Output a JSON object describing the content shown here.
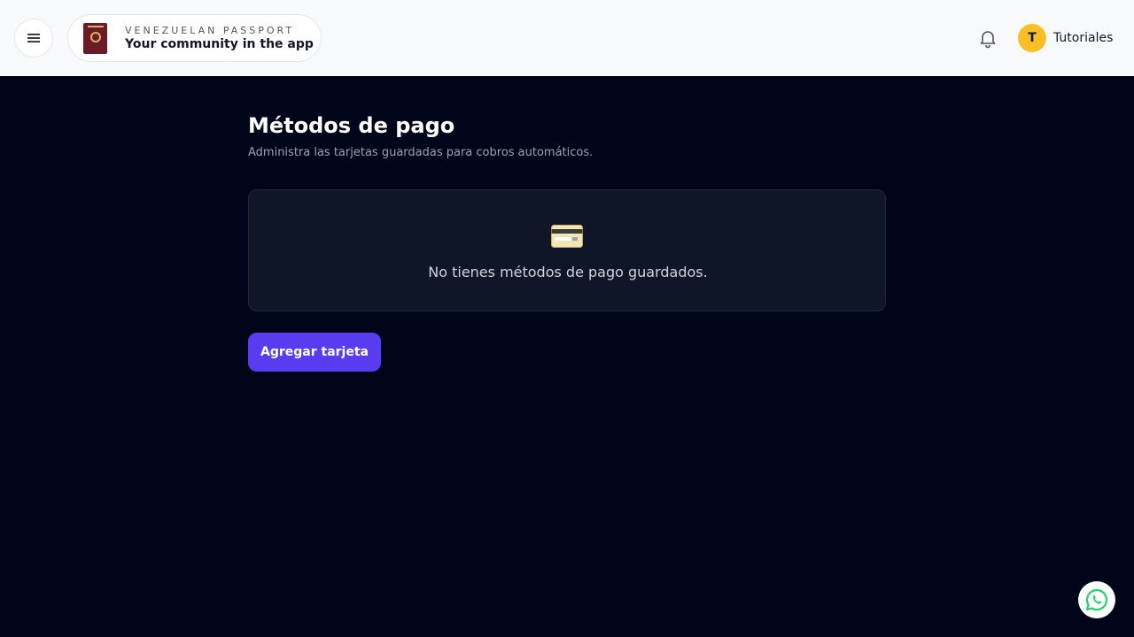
{
  "header": {
    "menu_icon": "hamburger-menu-icon",
    "brand": {
      "logo_icon": "venezuelan-passport-icon",
      "top_line": "VENEZUELAN PASSPORT",
      "bottom_line": "Your community in the app"
    },
    "notifications_icon": "bell-icon",
    "user": {
      "initial": "T",
      "name": "Tutoriales",
      "avatar_color": "#fbbf24"
    }
  },
  "main": {
    "title": "Métodos de pago",
    "subtitle": "Administra las tarjetas guardadas para cobros automáticos.",
    "empty_state": {
      "icon": "credit-card-icon",
      "message": "No tienes métodos de pago guardados."
    },
    "add_button_label": "Agregar tarjeta"
  },
  "floating": {
    "whatsapp_icon": "whatsapp-icon"
  },
  "colors": {
    "background": "#01051a",
    "accent": "#5a3cf0",
    "card": "#0e1628",
    "whatsapp": "#25d366"
  }
}
